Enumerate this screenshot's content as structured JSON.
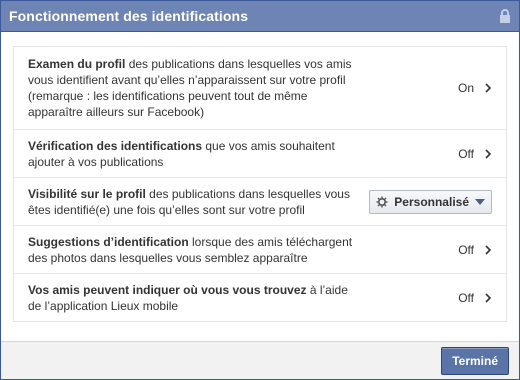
{
  "dialog": {
    "title": "Fonctionnement des identifications"
  },
  "rows": [
    {
      "title": "Examen du profil",
      "desc": " des publications dans lesquelles vos amis vous identifient avant qu’elles n’apparaissent sur votre profil (remarque : les identifications peuvent tout de même apparaître ailleurs sur Facebook)",
      "value": "On"
    },
    {
      "title": "Vérification des identifications",
      "desc": " que vos amis souhaitent ajouter à vos publications",
      "value": "Off"
    },
    {
      "title": "Visibilité sur le profil",
      "desc": " des publications dans lesquelles vous êtes identifié(e) une fois qu’elles sont sur votre profil",
      "select_value": "Personnalisé"
    },
    {
      "title": "Suggestions d’identification",
      "desc": " lorsque des amis téléchargent des photos dans lesquelles vous semblez apparaître",
      "value": "Off"
    },
    {
      "title": "Vos amis peuvent indiquer où vous vous trouvez",
      "desc": " à l’aide de l’application Lieux mobile",
      "value": "Off"
    }
  ],
  "footer": {
    "done_label": "Terminé"
  },
  "icons": {
    "lock": "lock-icon",
    "chevron": "chevron-right-icon",
    "gear": "gear-icon",
    "caret": "caret-down-icon"
  },
  "colors": {
    "title_bar": "#6d84b4",
    "button": "#5b74a8",
    "border": "#3b5998"
  }
}
